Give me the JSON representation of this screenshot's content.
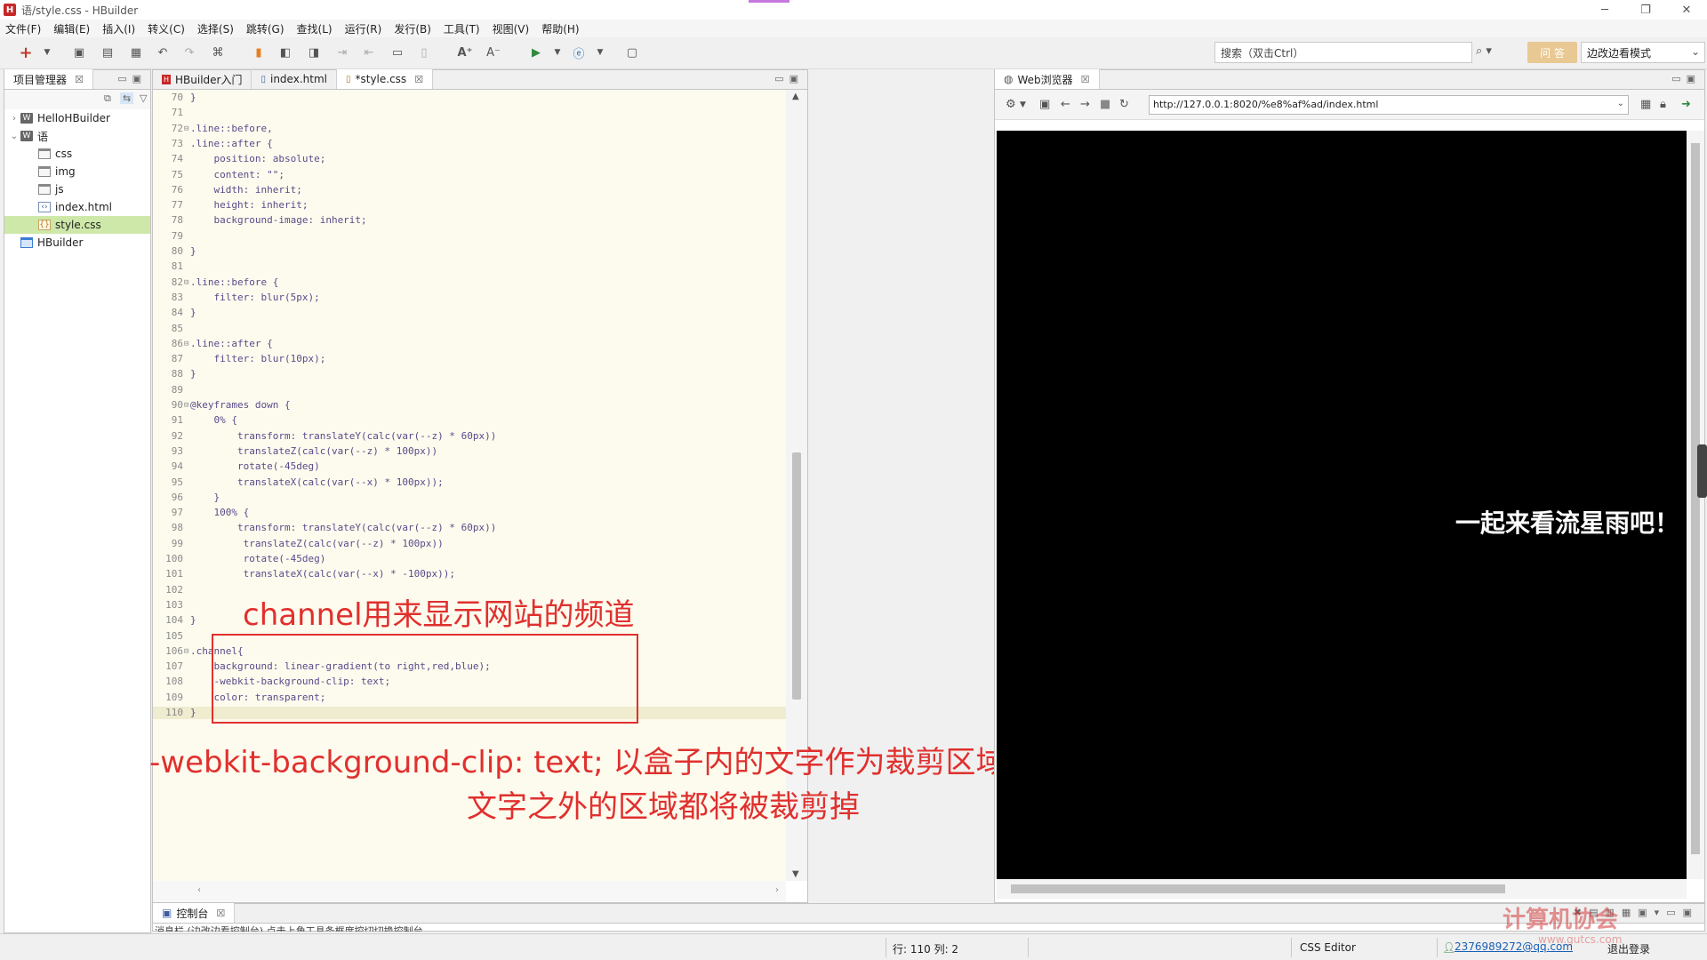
{
  "window": {
    "title": "语/style.css - HBuilder",
    "minimize": "─",
    "maximize": "❐",
    "close": "✕"
  },
  "menu": [
    "文件(F)",
    "编辑(E)",
    "插入(I)",
    "转义(C)",
    "选择(S)",
    "跳转(G)",
    "查找(L)",
    "运行(R)",
    "发行(B)",
    "工具(T)",
    "视图(V)",
    "帮助(H)"
  ],
  "toolbar": {
    "search_placeholder": "搜索（双击Ctrl）",
    "ask_label": "问 答",
    "mode_value": "边改边看模式"
  },
  "project_explorer": {
    "tab_label": "项目管理器",
    "tree": [
      {
        "label": "HelloHBuilder",
        "icon": "project-icon",
        "indent": 0,
        "arrow": "›",
        "selected": false
      },
      {
        "label": "语",
        "icon": "project-icon",
        "indent": 0,
        "arrow": "⌄",
        "selected": false
      },
      {
        "label": "css",
        "icon": "folder-icon",
        "indent": 1,
        "arrow": "",
        "selected": false
      },
      {
        "label": "img",
        "icon": "folder-icon",
        "indent": 1,
        "arrow": "",
        "selected": false
      },
      {
        "label": "js",
        "icon": "folder-icon",
        "indent": 1,
        "arrow": "",
        "selected": false
      },
      {
        "label": "index.html",
        "icon": "html-file-icon",
        "indent": 1,
        "arrow": "",
        "selected": false
      },
      {
        "label": "style.css",
        "icon": "css-file-icon",
        "indent": 1,
        "arrow": "",
        "selected": true
      },
      {
        "label": "HBuilder",
        "icon": "blue-folder-icon",
        "indent": 0,
        "arrow": "",
        "selected": false
      }
    ]
  },
  "editor": {
    "tabs": [
      {
        "label": "HBuilder入门",
        "icon": "hbuilder-icon",
        "active": false
      },
      {
        "label": "index.html",
        "icon": "html-file-icon",
        "active": false
      },
      {
        "label": "*style.css",
        "icon": "css-file-icon",
        "active": true
      }
    ],
    "lines": [
      {
        "n": "70",
        "fold": "",
        "code": "}"
      },
      {
        "n": "71",
        "fold": "",
        "code": ""
      },
      {
        "n": "72",
        "fold": "⊟",
        "code": ".line::before,"
      },
      {
        "n": "73",
        "fold": "",
        "code": ".line::after {"
      },
      {
        "n": "74",
        "fold": "",
        "code": "    position: absolute;"
      },
      {
        "n": "75",
        "fold": "",
        "code": "    content: \"\";"
      },
      {
        "n": "76",
        "fold": "",
        "code": "    width: inherit;"
      },
      {
        "n": "77",
        "fold": "",
        "code": "    height: inherit;"
      },
      {
        "n": "78",
        "fold": "",
        "code": "    background-image: inherit;"
      },
      {
        "n": "79",
        "fold": "",
        "code": ""
      },
      {
        "n": "80",
        "fold": "",
        "code": "}"
      },
      {
        "n": "81",
        "fold": "",
        "code": ""
      },
      {
        "n": "82",
        "fold": "⊟",
        "code": ".line::before {"
      },
      {
        "n": "83",
        "fold": "",
        "code": "    filter: blur(5px);"
      },
      {
        "n": "84",
        "fold": "",
        "code": "}"
      },
      {
        "n": "85",
        "fold": "",
        "code": ""
      },
      {
        "n": "86",
        "fold": "⊟",
        "code": ".line::after {"
      },
      {
        "n": "87",
        "fold": "",
        "code": "    filter: blur(10px);"
      },
      {
        "n": "88",
        "fold": "",
        "code": "}"
      },
      {
        "n": "89",
        "fold": "",
        "code": ""
      },
      {
        "n": "90",
        "fold": "⊟",
        "code": "@keyframes down {"
      },
      {
        "n": "91",
        "fold": "",
        "code": "    0% {"
      },
      {
        "n": "92",
        "fold": "",
        "code": "        transform: translateY(calc(var(--z) * 60px))"
      },
      {
        "n": "93",
        "fold": "",
        "code": "        translateZ(calc(var(--z) * 100px))"
      },
      {
        "n": "94",
        "fold": "",
        "code": "        rotate(-45deg)"
      },
      {
        "n": "95",
        "fold": "",
        "code": "        translateX(calc(var(--x) * 100px));"
      },
      {
        "n": "96",
        "fold": "",
        "code": "    }"
      },
      {
        "n": "97",
        "fold": "",
        "code": "    100% {"
      },
      {
        "n": "98",
        "fold": "",
        "code": "        transform: translateY(calc(var(--z) * 60px))"
      },
      {
        "n": "99",
        "fold": "",
        "code": "         translateZ(calc(var(--z) * 100px))"
      },
      {
        "n": "100",
        "fold": "",
        "code": "         rotate(-45deg)"
      },
      {
        "n": "101",
        "fold": "",
        "code": "         translateX(calc(var(--x) * -100px));"
      },
      {
        "n": "102",
        "fold": "",
        "code": ""
      },
      {
        "n": "103",
        "fold": "",
        "code": ""
      },
      {
        "n": "104",
        "fold": "",
        "code": "}"
      },
      {
        "n": "105",
        "fold": "",
        "code": ""
      },
      {
        "n": "106",
        "fold": "⊟",
        "code": ".channel{"
      },
      {
        "n": "107",
        "fold": "",
        "code": "    background: linear-gradient(to right,red,blue);"
      },
      {
        "n": "108",
        "fold": "",
        "code": "    -webkit-background-clip: text;"
      },
      {
        "n": "109",
        "fold": "",
        "code": "    color: transparent;"
      },
      {
        "n": "110",
        "fold": "",
        "code": "}"
      }
    ],
    "current_line": "110"
  },
  "annotations": {
    "heading": "channel用来显示网站的频道",
    "note_line1": "-webkit-background-clip: text;   以盒子内的文字作为裁剪区域向外裁剪，",
    "note_line2": "文字之外的区域都将被裁剪掉",
    "color": "#e0302e"
  },
  "browser": {
    "tab_label": "Web浏览器",
    "url": "http://127.0.0.1:8020/%e8%af%ad/index.html",
    "page_text": "一起来看流星雨吧！"
  },
  "console": {
    "tab_label": "控制台",
    "text": "消息栏 (边改边看控制台)  点击上角工具条框度控切切换控制台"
  },
  "statusbar": {
    "position": "行: 110 列: 2",
    "editor_type": "CSS Editor",
    "user": "2376989272@qq.com",
    "login": "退出登录"
  },
  "watermark": {
    "title": "计算机协会",
    "url": "www.gutcs.com"
  }
}
